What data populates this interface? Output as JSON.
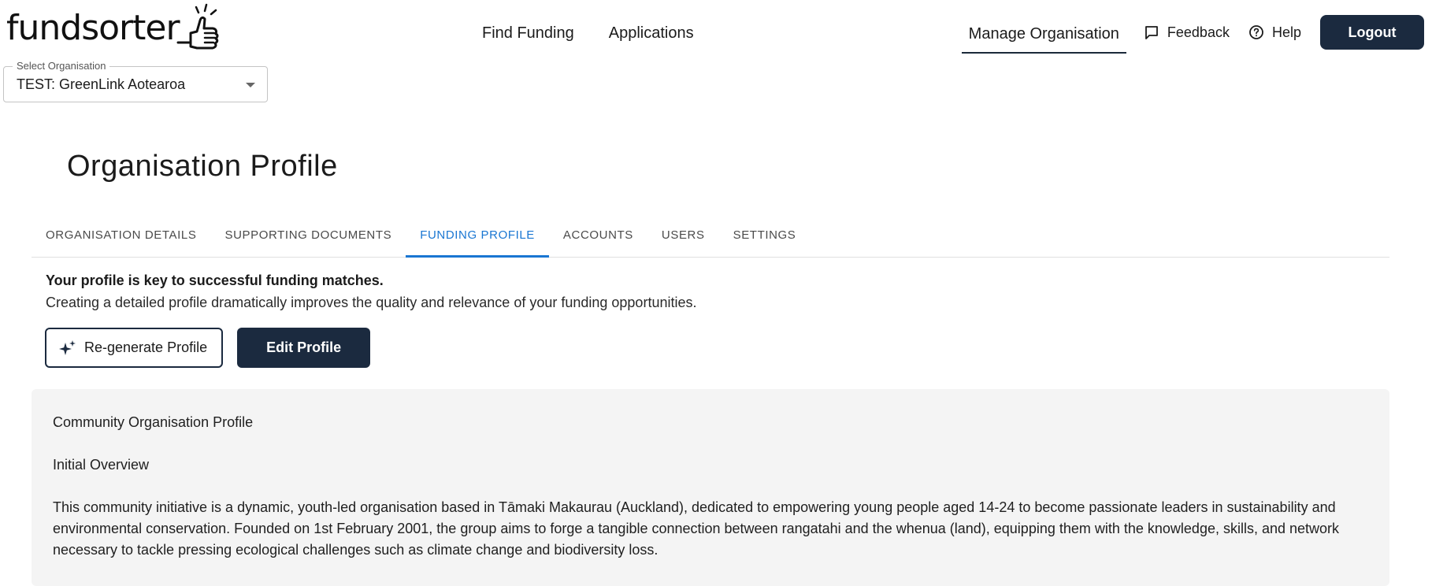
{
  "brand": {
    "logo_text": "fundsorter"
  },
  "nav": {
    "find_funding": "Find Funding",
    "applications": "Applications",
    "manage_organisation": "Manage Organisation",
    "feedback": "Feedback",
    "help": "Help",
    "logout": "Logout"
  },
  "org_select": {
    "label": "Select Organisation",
    "value": "TEST: GreenLink Aotearoa"
  },
  "page": {
    "title": "Organisation Profile"
  },
  "tabs": [
    {
      "label": "ORGANISATION DETAILS"
    },
    {
      "label": "SUPPORTING DOCUMENTS"
    },
    {
      "label": "FUNDING PROFILE",
      "active": true
    },
    {
      "label": "ACCOUNTS"
    },
    {
      "label": "USERS"
    },
    {
      "label": "SETTINGS"
    }
  ],
  "intro": {
    "headline": "Your profile is key to successful funding matches.",
    "body": "Creating a detailed profile dramatically improves the quality and relevance of your funding opportunities."
  },
  "actions": {
    "regenerate": "Re-generate Profile",
    "edit": "Edit Profile"
  },
  "profile": {
    "heading": "Community Organisation Profile",
    "section": "Initial Overview",
    "paragraph": "This community initiative is a dynamic, youth-led organisation based in Tāmaki Makaurau (Auckland), dedicated to empowering young people aged 14-24 to become passionate leaders in sustainability and environmental conservation. Founded on 1st February 2001, the group aims to forge a tangible connection between rangatahi and the whenua (land), equipping them with the knowledge, skills, and network necessary to tackle pressing ecological challenges such as climate change and biodiversity loss."
  },
  "icons": {
    "logo": "thumbs-up-icon",
    "feedback": "chat-bubble-icon",
    "help": "question-circle-icon",
    "regenerate": "sparkle-icon",
    "select_caret": "caret-down-icon"
  },
  "colors": {
    "primary_dark": "#1b2a3f",
    "tab_active": "#1976d2",
    "panel_bg": "#f4f4f4"
  }
}
